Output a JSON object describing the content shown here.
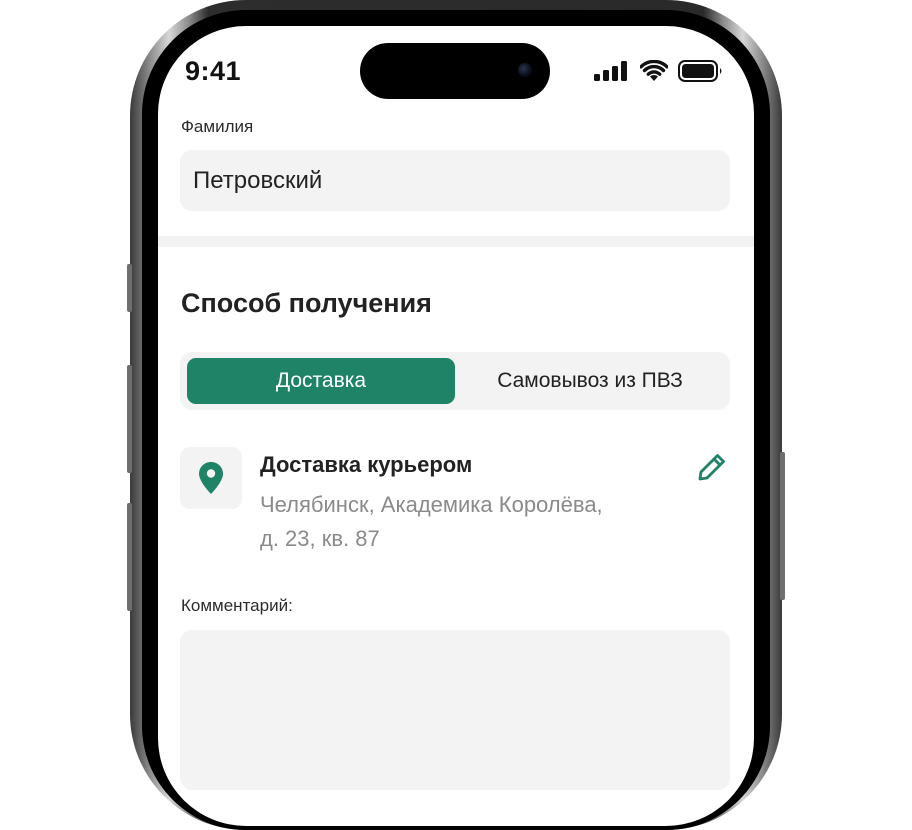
{
  "status_bar": {
    "time": "9:41"
  },
  "form": {
    "surname": {
      "label": "Фамилия",
      "value": "Петровский"
    }
  },
  "receiving": {
    "title": "Способ получения",
    "tabs": [
      {
        "label": "Доставка",
        "active": true
      },
      {
        "label": "Самовывоз из ПВЗ",
        "active": false
      }
    ],
    "delivery": {
      "title": "Доставка курьером",
      "address_line1": "Челябинск, Академика Королёва,",
      "address_line2": "д. 23, кв. 87"
    }
  },
  "comment": {
    "label": "Комментарий:",
    "value": ""
  },
  "icons": {
    "location": "map-pin-icon",
    "edit": "pencil-icon",
    "signal": "cellular-signal-icon",
    "wifi": "wifi-icon",
    "battery": "battery-icon"
  },
  "colors": {
    "accent": "#1E8367",
    "field_bg": "#F3F3F3",
    "secondary_text": "#8A8A8A"
  }
}
